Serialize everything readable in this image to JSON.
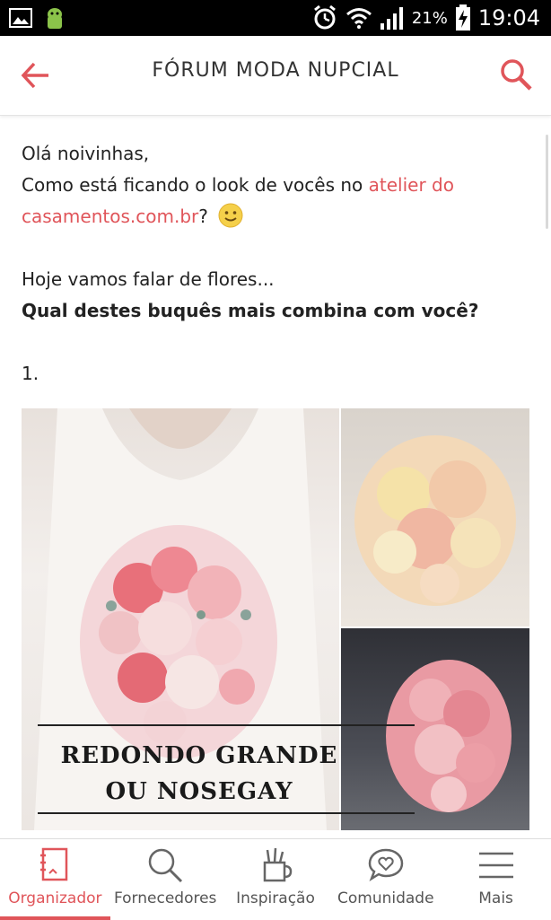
{
  "status_bar": {
    "battery_percent": "21%",
    "time": "19:04"
  },
  "header": {
    "title": "FÓRUM MODA NUPCIAL"
  },
  "post": {
    "greeting": "Olá noivinhas,",
    "line2_before": "Como está ficando o look de vocês no ",
    "line2_link": "atelier do casamentos.com.br",
    "line2_after": "?",
    "line3": "Hoje vamos falar de flores...",
    "question": "Qual destes buquês mais combina com você?",
    "item_number": "1."
  },
  "image": {
    "caption_line1": "REDONDO GRANDE",
    "caption_line2": "OU NOSEGAY"
  },
  "bottom_nav": {
    "items": [
      {
        "label": "Organizador",
        "icon": "notebook-icon",
        "active": true
      },
      {
        "label": "Fornecedores",
        "icon": "search-icon",
        "active": false
      },
      {
        "label": "Inspiração",
        "icon": "pencil-cup-icon",
        "active": false
      },
      {
        "label": "Comunidade",
        "icon": "chat-heart-icon",
        "active": false
      },
      {
        "label": "Mais",
        "icon": "menu-icon",
        "active": false
      }
    ]
  },
  "colors": {
    "accent": "#e0555a",
    "text": "#222222"
  }
}
